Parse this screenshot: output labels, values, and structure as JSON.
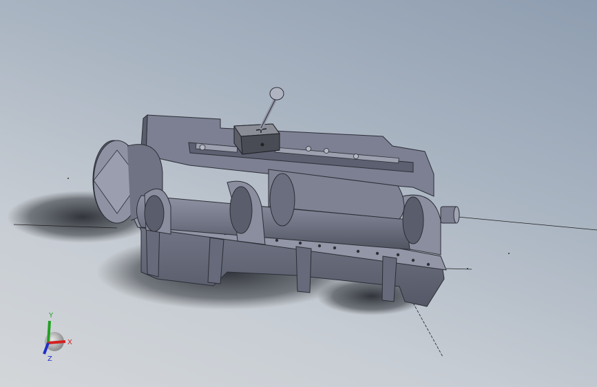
{
  "viewport": {
    "background_top": "#8e9db0",
    "background_bottom": "#d3d6d9"
  },
  "model": {
    "body_color": "#6f7384",
    "body_shadow_color": "#4c4f5c",
    "highlight_color": "#9ea2b2",
    "block_color": "#5c5e68"
  },
  "triad": {
    "x_label": "X",
    "y_label": "Y",
    "z_label": "Z",
    "x_color": "#d22020",
    "y_color": "#22a022",
    "z_color": "#2030c8"
  }
}
